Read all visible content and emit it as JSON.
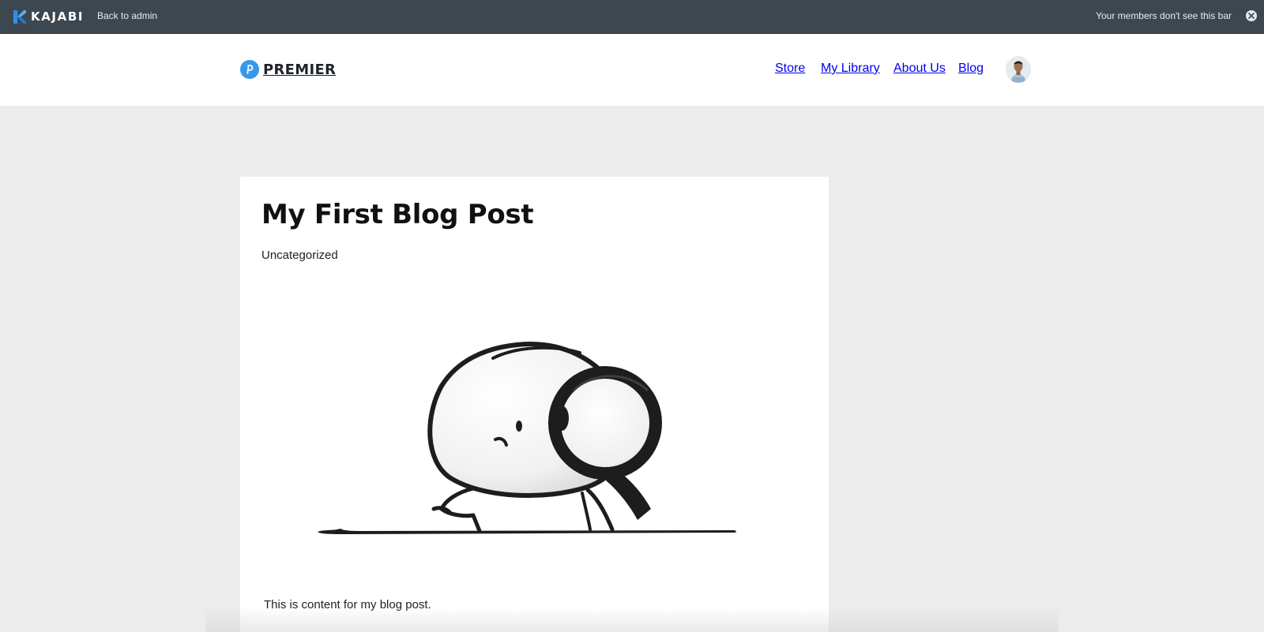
{
  "admin_bar": {
    "brand": "KAJABI",
    "back_link": "Back to admin",
    "notice": "Your members don't see this bar"
  },
  "header": {
    "brand": "PREMIER",
    "nav": [
      {
        "label": "Store"
      },
      {
        "label": "My Library"
      },
      {
        "label": "About Us"
      },
      {
        "label": "Blog"
      }
    ]
  },
  "post": {
    "title": "My First Blog Post",
    "category": "Uncategorized",
    "body": "This is content for my blog post."
  },
  "icons": {
    "kajabi": "kajabi-logo-icon",
    "close": "close-icon",
    "brand": "premier-logo-icon",
    "avatar": "user-avatar",
    "illustration": "magnifying-glass-character-illustration"
  },
  "colors": {
    "admin_bar": "#3c474f",
    "accent": "#3897e8",
    "page_bg": "#ececec"
  }
}
